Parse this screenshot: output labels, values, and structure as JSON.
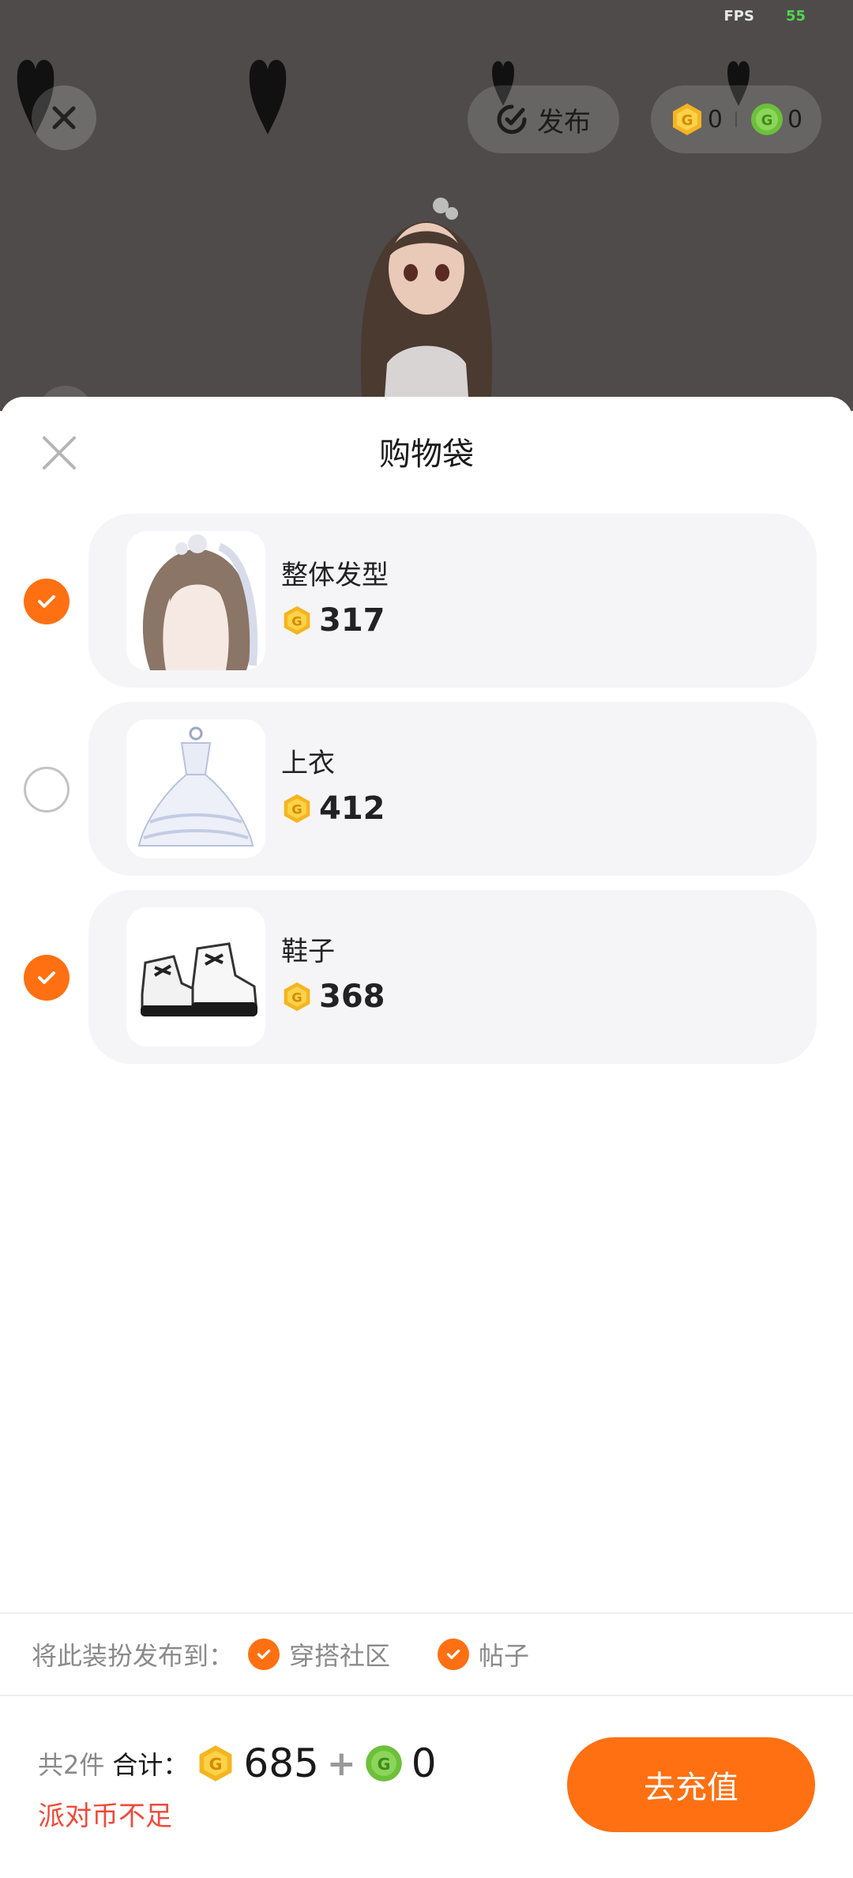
{
  "status": {
    "fps_label": "FPS",
    "fps_value": "55"
  },
  "top_bar": {
    "publish_label": "发布",
    "gold_coin_balance": "0",
    "green_coin_balance": "0"
  },
  "sheet": {
    "title": "购物袋",
    "items": [
      {
        "name": "整体发型",
        "price": "317",
        "selected": true,
        "thumb_icon": "hairstyle-icon"
      },
      {
        "name": "上衣",
        "price": "412",
        "selected": false,
        "thumb_icon": "dress-icon"
      },
      {
        "name": "鞋子",
        "price": "368",
        "selected": true,
        "thumb_icon": "boots-icon"
      }
    ]
  },
  "publish_to": {
    "label": "将此装扮发布到：",
    "options": [
      {
        "label": "穿搭社区",
        "checked": true
      },
      {
        "label": "帖子",
        "checked": true
      }
    ]
  },
  "total": {
    "count_text": "共2件",
    "sum_label": "合计：",
    "gold_total": "685",
    "plus": "+",
    "green_total": "0",
    "warning": "派对币不足",
    "recharge_label": "去充值"
  },
  "colors": {
    "accent": "#ff7012",
    "gold_coin": "#f5b520",
    "green_coin": "#6cc03a",
    "warning": "#f04a3a"
  }
}
